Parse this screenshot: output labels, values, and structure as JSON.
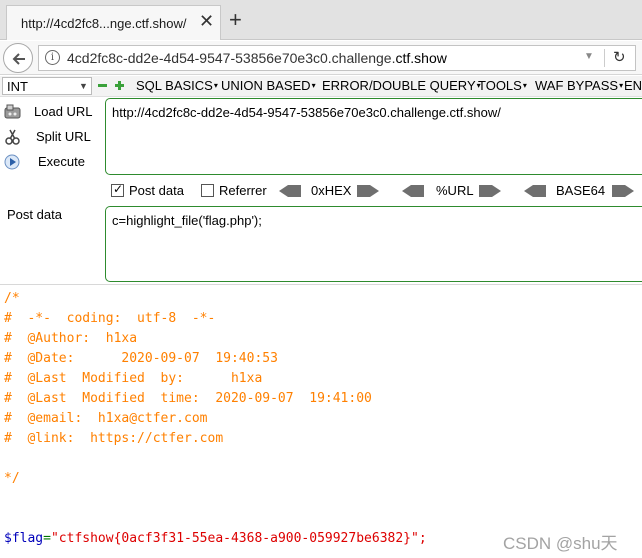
{
  "browser": {
    "tab_title": "http://4cd2fc8...nge.ctf.show/",
    "tab_close": "✕",
    "new_tab": "+",
    "url_prefix": "4cd2fc8c-dd2e-4d54-9547-53856e70e3c0.challenge.",
    "url_domain": "ctf.show",
    "info_icon": "i",
    "dropdown_icon": "▼",
    "reload_icon": "↻"
  },
  "hackbar": {
    "type_select": "INT",
    "menus": [
      {
        "label": "SQL BASICS"
      },
      {
        "label": "UNION BASED"
      },
      {
        "label": "ERROR/DOUBLE QUERY"
      },
      {
        "label": "TOOLS"
      },
      {
        "label": "WAF BYPASS"
      },
      {
        "label": "EN"
      }
    ],
    "actions": {
      "load_url": "Load URL",
      "split_url": "Split URL",
      "execute": "Execute"
    },
    "url_value": "http://4cd2fc8c-dd2e-4d54-9547-53856e70e3c0.challenge.ctf.show/",
    "post_data_label": "Post data",
    "post_data_checked": true,
    "referrer_label": "Referrer",
    "referrer_checked": false,
    "encodings": [
      "0xHEX",
      "%URL",
      "BASE64"
    ],
    "post_field_label": "Post data",
    "post_value": "c=highlight_file('flag.php');"
  },
  "source": {
    "comment_lines": [
      "/*",
      "#  -*-  coding:  utf-8  -*-",
      "#  @Author:  h1xa",
      "#  @Date:      2020-09-07  19:40:53",
      "#  @Last  Modified  by:      h1xa",
      "#  @Last  Modified  time:  2020-09-07  19:41:00",
      "#  @email:  h1xa@ctfer.com",
      "#  @link:  https://ctfer.com",
      "",
      "*/"
    ],
    "flag_var": "$flag",
    "flag_op": "=",
    "flag_value": "\"ctfshow{0acf3f31-55ea-4368-a900-059927be6382}\";"
  },
  "watermark": "CSDN @shu天",
  "colors": {
    "comment": "#ff8000",
    "variable": "#0000bb",
    "operator": "#007700",
    "string": "#dd0000",
    "box_border": "#2e8b2e"
  }
}
